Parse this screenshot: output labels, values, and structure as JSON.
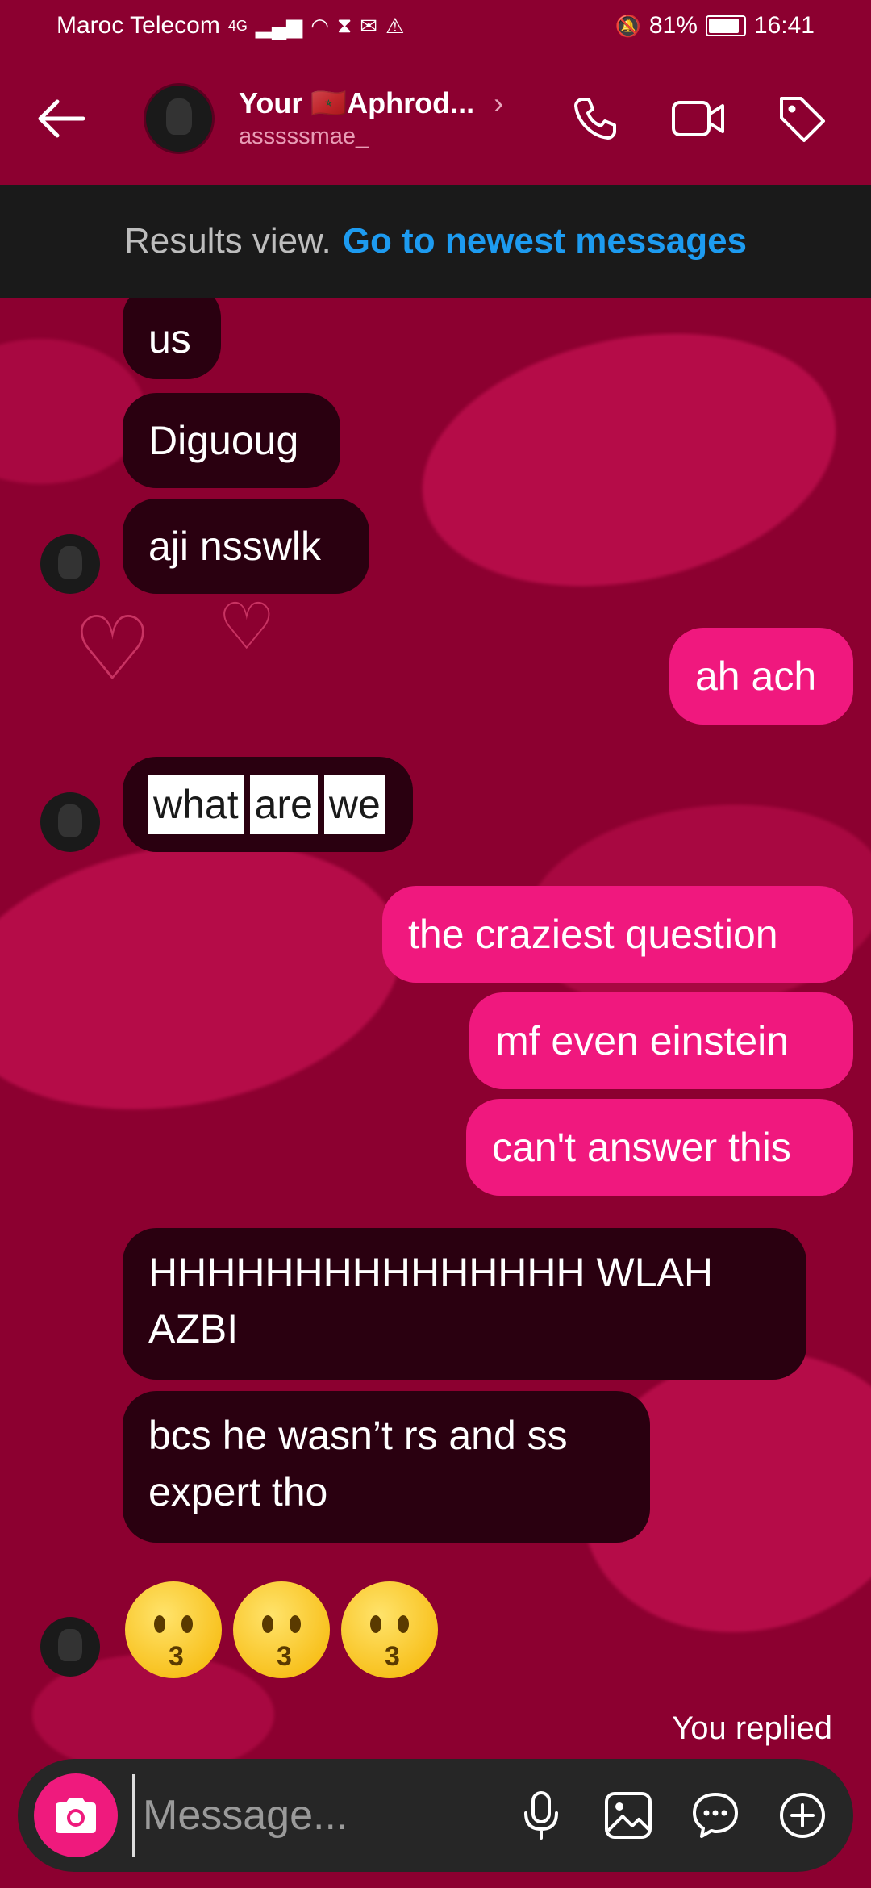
{
  "status_bar": {
    "carrier": "Maroc Telecom",
    "network": "4G",
    "battery": "81%",
    "time": "16:41"
  },
  "header": {
    "name": "Your 🇲🇦Aphrod...",
    "username": "asssssmae_"
  },
  "banner": {
    "text": "Results view.",
    "link": "Go to newest messages"
  },
  "messages": {
    "m1": "us",
    "m2": "Diguoug",
    "m3": "aji nsswlk",
    "m4": "ah ach",
    "m5_words": [
      "what",
      "are",
      "we"
    ],
    "m6": "the craziest question",
    "m7": "mf even einstein",
    "m8": "can't answer this",
    "m9_l1": "HHHHHHHHHHHHHHH WLAH",
    "m9_l2": "AZBI",
    "m10_l1": "bcs he wasn’t rs and ss",
    "m10_l2": "expert tho",
    "emoji_count": 3,
    "emoji_name": "kissing-face"
  },
  "you_replied": "You replied",
  "composer": {
    "placeholder": "Message..."
  },
  "colors": {
    "background": "#8c0030",
    "incoming_bubble": "#2a0010",
    "outgoing_bubble": "#f0187e",
    "link": "#1d9bf0",
    "camera_button": "#ef1a7d"
  }
}
